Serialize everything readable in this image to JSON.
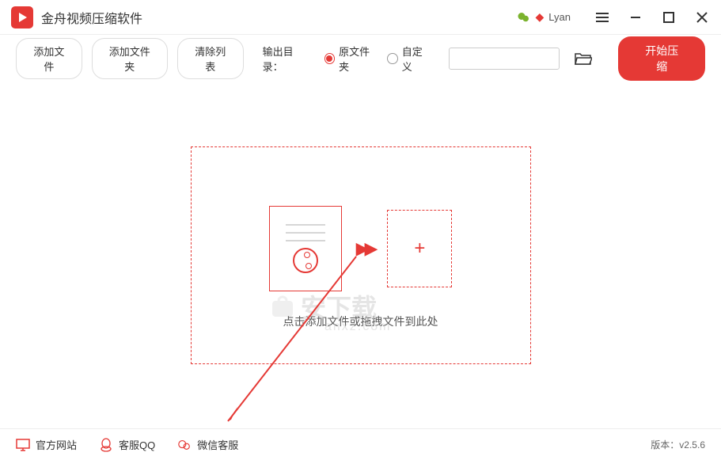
{
  "titlebar": {
    "app_name": "金舟视频压缩软件",
    "username": "Lyan"
  },
  "toolbar": {
    "add_file": "添加文件",
    "add_folder": "添加文件夹",
    "clear_list": "清除列表",
    "output_label": "输出目录：",
    "radio_source": "原文件夹",
    "radio_custom": "自定义",
    "path_value": "",
    "start_button": "开始压缩"
  },
  "dropzone": {
    "hint_text": "点击添加文件或拖拽文件到此处"
  },
  "watermark": {
    "text": "安下载",
    "sub": "anxz.com"
  },
  "footer": {
    "official_site": "官方网站",
    "qq_support": "客服QQ",
    "wechat_support": "微信客服",
    "version_prefix": "版本：",
    "version": "v2.5.6"
  }
}
